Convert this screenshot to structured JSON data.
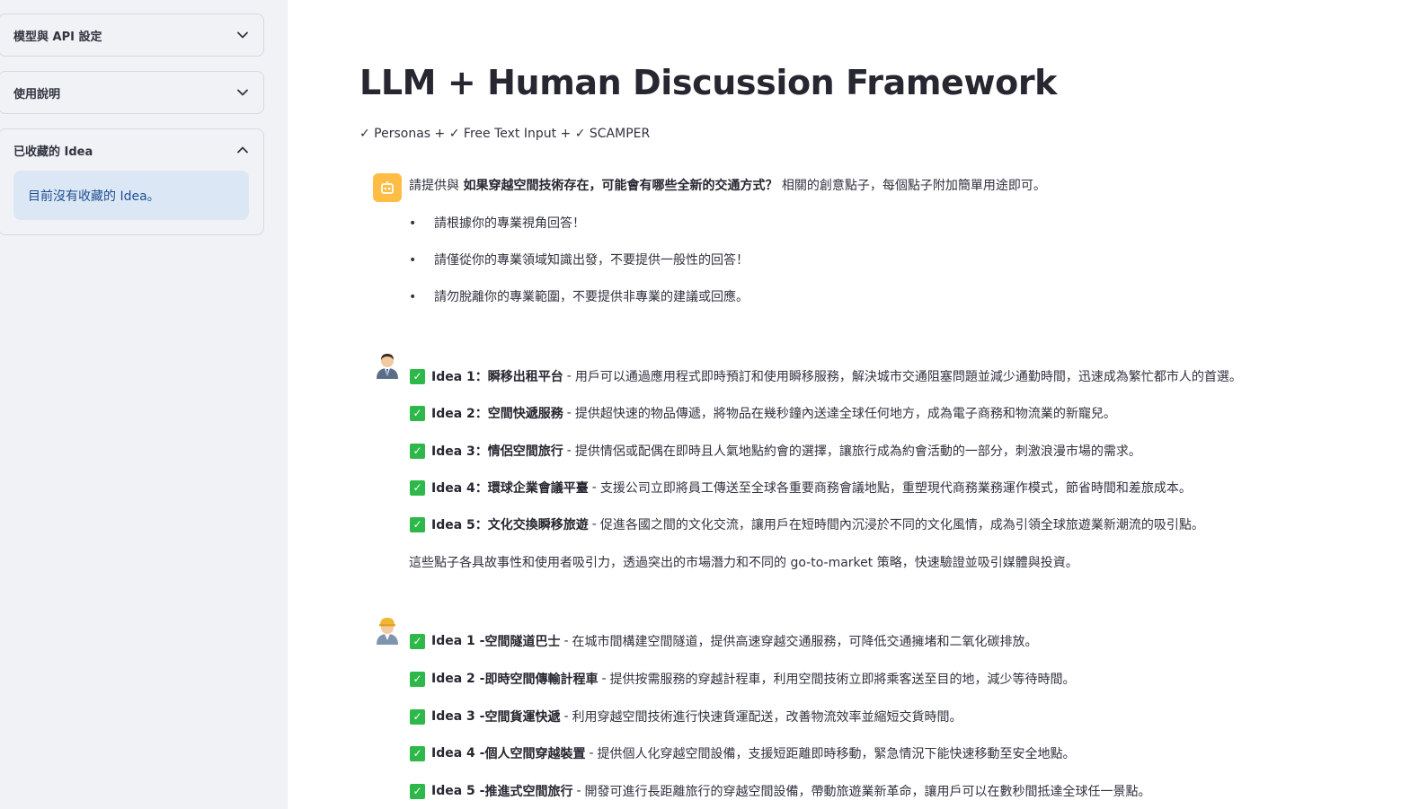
{
  "sidebar": {
    "model_expander_label": "模型與 API 設定",
    "help_expander_label": "使用說明",
    "saved_expander_label": "已收藏的 Idea",
    "saved_empty_text": "目前沒有收藏的 Idea。"
  },
  "main": {
    "title": "LLM + Human Discussion Framework",
    "subtitle": "✓ Personas + ✓ Free Text Input + ✓ SCAMPER",
    "prompt": {
      "prefix": "請提供與",
      "topic": "如果穿越空間技術存在，可能會有哪些全新的交通方式？",
      "suffix": "相關的創意點子，每個點子附加簡單用途即可。",
      "bullets": [
        "請根據你的專業視角回答！",
        "請僅從你的專業領域知識出發，不要提供一般性的回答！",
        "請勿脫離你的專業範圍，不要提供非專業的建議或回應。"
      ]
    },
    "responses": [
      {
        "avatar": "businessman-icon",
        "ideas": [
          {
            "num": "Idea 1：",
            "name": "瞬移出租平台",
            "desc": "用戶可以通過應用程式即時預訂和使用瞬移服務，解決城市交通阻塞問題並減少通勤時間，迅速成為繁忙都市人的首選。"
          },
          {
            "num": "Idea 2：",
            "name": "空間快遞服務",
            "desc": "提供超快速的物品傳遞，將物品在幾秒鐘內送達全球任何地方，成為電子商務和物流業的新寵兒。"
          },
          {
            "num": "Idea 3：",
            "name": "情侶空間旅行",
            "desc": "提供情侶或配偶在即時且人氣地點約會的選擇，讓旅行成為約會活動的一部分，刺激浪漫市場的需求。"
          },
          {
            "num": "Idea 4：",
            "name": "環球企業會議平臺",
            "desc": "支援公司立即將員工傳送至全球各重要商務會議地點，重塑現代商務業務運作模式，節省時間和差旅成本。"
          },
          {
            "num": "Idea 5：",
            "name": "文化交換瞬移旅遊",
            "desc": "促進各國之間的文化交流，讓用戶在短時間內沉浸於不同的文化風情，成為引領全球旅遊業新潮流的吸引點。"
          }
        ],
        "summary": "這些點子各具故事性和使用者吸引力，透過突出的市場潛力和不同的 go-to-market 策略，快速驗證並吸引媒體與投資。"
      },
      {
        "avatar": "engineer-icon",
        "ideas": [
          {
            "num": "Idea 1 - ",
            "name": "空間隧道巴士",
            "desc": "在城市間構建空間隧道，提供高速穿越交通服務，可降低交通擁堵和二氧化碳排放。"
          },
          {
            "num": "Idea 2 - ",
            "name": "即時空間傳輸計程車",
            "desc": "提供按需服務的穿越計程車，利用空間技術立即將乘客送至目的地，減少等待時間。"
          },
          {
            "num": "Idea 3 - ",
            "name": "空間貨運快遞",
            "desc": "利用穿越空間技術進行快速貨運配送，改善物流效率並縮短交貨時間。"
          },
          {
            "num": "Idea 4 - ",
            "name": "個人空間穿越裝置",
            "desc": "提供個人化穿越空間設備，支援短距離即時移動，緊急情況下能快速移動至安全地點。"
          },
          {
            "num": "Idea 5 - ",
            "name": "推進式空間旅行",
            "desc": "開發可進行長距離旅行的穿越空間設備，帶動旅遊業新革命，讓用戶可以在數秒間抵達全球任一景點。"
          }
        ]
      }
    ]
  },
  "colors": {
    "sidebar_bg": "#f0f2f6",
    "info_bg": "#dce7f5",
    "info_text": "#1d4f91",
    "bot_avatar": "#ffbd45",
    "check_green": "#2eb84a"
  }
}
